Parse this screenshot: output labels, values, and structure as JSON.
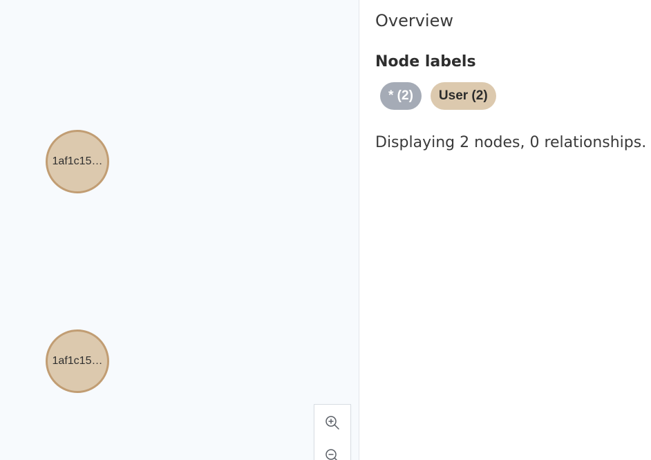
{
  "graph": {
    "nodes": [
      {
        "caption": "1af1c15…",
        "label": "User"
      },
      {
        "caption": "1af1c15…",
        "label": "User"
      }
    ],
    "zoom": {
      "zoom_in_icon": "zoom-in-icon",
      "zoom_out_icon": "zoom-out-icon"
    }
  },
  "overview": {
    "title": "Overview",
    "node_labels_heading": "Node labels",
    "labels": [
      {
        "text": "* (2)",
        "color": "#a5abb6"
      },
      {
        "text": "User (2)",
        "color": "#dcc9ae"
      }
    ],
    "summary": "Displaying 2 nodes, 0 relationships."
  },
  "colors": {
    "canvas_bg": "#f7fafd",
    "node_fill": "#dcc9ae",
    "node_border": "#c19d73"
  }
}
